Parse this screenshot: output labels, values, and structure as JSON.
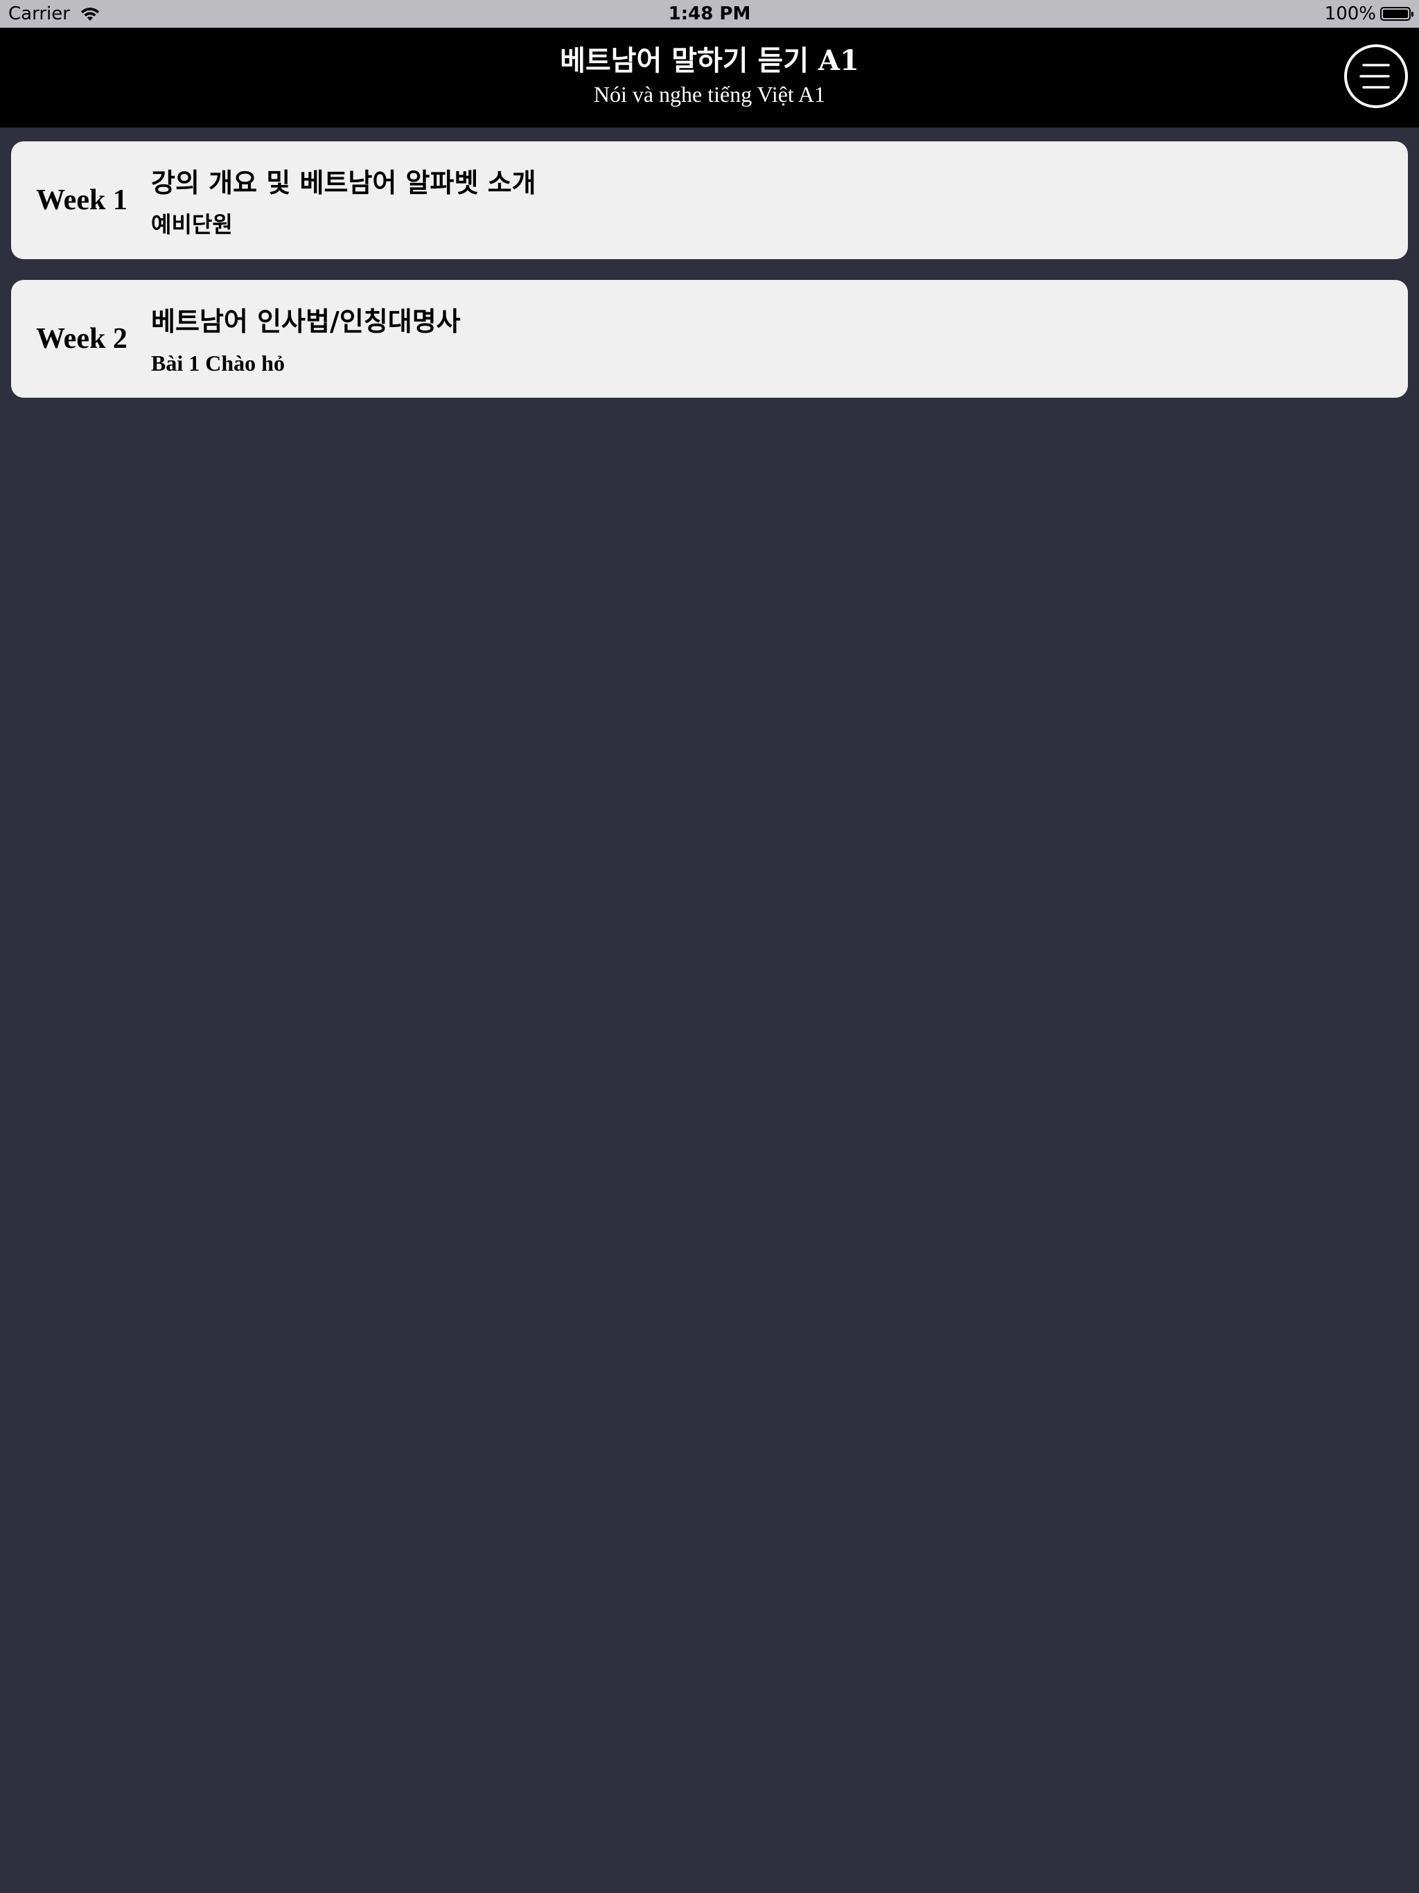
{
  "status_bar": {
    "carrier": "Carrier",
    "time": "1:48 PM",
    "battery_percent": "100%",
    "battery_level": 1.0,
    "wifi_icon": "wifi-icon",
    "battery_icon": "battery-icon"
  },
  "header": {
    "title": "베트남어 말하기 듣기 A1",
    "subtitle": "Nói và nghe tiếng Việt A1",
    "menu_icon": "hamburger-menu-icon"
  },
  "weeks": [
    {
      "label": "Week 1",
      "title": "강의 개요 및 베트남어 알파벳 소개",
      "subtitle": "예비단원"
    },
    {
      "label": "Week 2",
      "title": "베트남어 인사법/인칭대명사",
      "subtitle": "Bài 1 Chào hỏ"
    }
  ],
  "colors": {
    "background": "#2f303d",
    "status_bar": "#bcbcc1",
    "nav_bar": "#000000",
    "card": "#f0f0f0"
  }
}
